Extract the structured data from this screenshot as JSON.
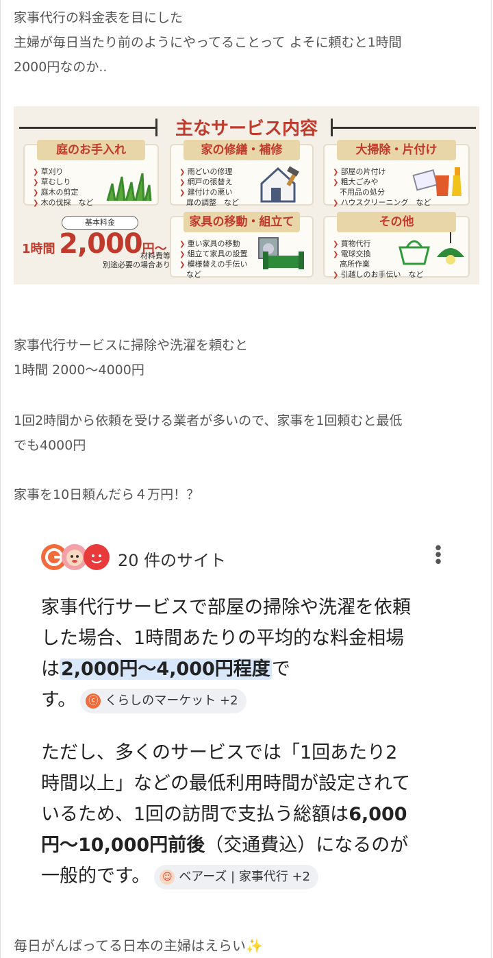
{
  "post": {
    "intro_lines": [
      "家事代行の料金表を目にした",
      "主婦が毎日当たり前のようにやってることって よそに頼むと1時間",
      "2000円なのか.."
    ],
    "paragraph1": [
      "家事代行サービスに掃除や洗濯を頼むと",
      "1時間 2000〜4000円"
    ],
    "paragraph2": [
      "1回2時間から依頼を受ける業者が多いので、家事を1回頼むと最低",
      "でも4000円"
    ],
    "paragraph3": "家事を10日頼んだら４万円！？",
    "closing": "毎日がんばってる日本の主婦はえらい✨"
  },
  "service_image": {
    "title": "主なサービス内容",
    "boxes": [
      {
        "title": "庭のお手入れ",
        "items": [
          "草刈り",
          "草むしり",
          "庭木の剪定",
          "木の伐採　など"
        ]
      },
      {
        "title": "家の修繕・補修",
        "items": [
          "雨どいの修理",
          "網戸の張替え",
          "建付けの悪い",
          "扉の調整　など"
        ]
      },
      {
        "title": "大掃除・片付け",
        "items": [
          "部屋の片付け",
          "粗大ごみや",
          "不用品の処分",
          "ハウスクリーニング　など"
        ]
      },
      {
        "title": "家具の移動・組立て",
        "items": [
          "重い家具の移動",
          "組立て家具の設置",
          "模様替えの手伝い",
          "など"
        ]
      },
      {
        "title": "その他",
        "items": [
          "買物代行",
          "電球交換",
          "高所作業",
          "引越しのお手伝い　など"
        ]
      }
    ],
    "price_tag": "基本料金",
    "price_prefix": "1時間",
    "price_amount": "2,000",
    "price_suffix": "円〜",
    "price_note": [
      "材料費等",
      "別途必要の場合あり"
    ]
  },
  "ai_card": {
    "sites_label": "20 件のサイト",
    "s1_a": "家事代行サービスで部屋の掃除や洗濯を依頼",
    "s1_b": "した場合、1時間あたりの平均的な料金相場",
    "s1_c": "は",
    "s1_highlight": "2,000円〜4,000円程度",
    "s1_d": "で",
    "s1_e": "す。",
    "chip1": "くらしのマーケット +2",
    "s2_a": "ただし、多くのサービスでは「1回あたり2",
    "s2_b": "時間以上」などの最低利用時間が設定されて",
    "s2_c": "いるため、1回の訪問で支払う総額は",
    "s2_bold1": "6,000",
    "s2_bold2": "円〜10,000円前後",
    "s2_d": "（交通費込）になるのが",
    "s2_e": "一般的です。",
    "chip2": "ベアーズ | 家事代行 +2",
    "colors": {
      "highlight": "#d9e7fb",
      "chip_bg": "#eef0f3",
      "kurashi": "#f26b3a",
      "bears": "#e8453c"
    }
  }
}
